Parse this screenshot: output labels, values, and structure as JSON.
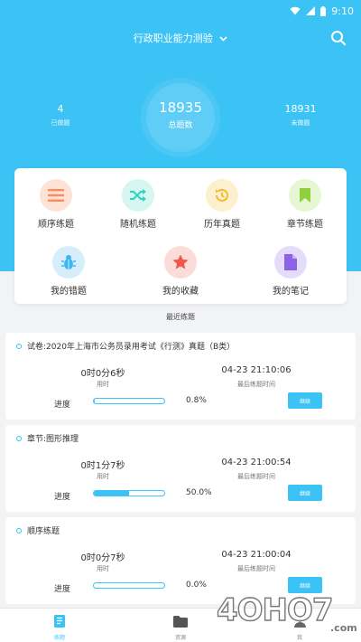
{
  "status_bar": {
    "time": "9:10"
  },
  "header": {
    "title": "行政职业能力测验",
    "stats": {
      "left": {
        "num": "4",
        "label": "已做题"
      },
      "center": {
        "num": "18935",
        "label": "总题数"
      },
      "right": {
        "num": "18931",
        "label": "未做题"
      }
    }
  },
  "menu": {
    "items": [
      {
        "label": "顺序练题",
        "icon": "list-icon",
        "color": "#ff8a5c",
        "bg": "#fde3d6"
      },
      {
        "label": "随机练题",
        "icon": "shuffle-icon",
        "color": "#2ed3c5",
        "bg": "#d6f6f2"
      },
      {
        "label": "历年真题",
        "icon": "history-icon",
        "color": "#f5b92c",
        "bg": "#fdf0cf"
      },
      {
        "label": "章节练题",
        "icon": "bookmark-icon",
        "color": "#8fd13c",
        "bg": "#e7f6d3"
      },
      {
        "label": "我的错题",
        "icon": "bug-icon",
        "color": "#3cb5f0",
        "bg": "#d6eefc"
      },
      {
        "label": "我的收藏",
        "icon": "star-icon",
        "color": "#f0564a",
        "bg": "#fcdcd8"
      },
      {
        "label": "我的笔记",
        "icon": "note-icon",
        "color": "#8c63e6",
        "bg": "#e5dcfa"
      }
    ]
  },
  "recent": {
    "title": "最近练题",
    "cards": [
      {
        "title": "试卷:2020年上海市公务员录用考试《行测》真题（B类）",
        "time_value": "0时0分6秒",
        "time_label": "用时",
        "last_value": "04-23 21:10:06",
        "last_label": "最后练题时间",
        "progress_label": "进度",
        "progress": 0.8,
        "progress_text": "0.8%",
        "button": "继续"
      },
      {
        "title": "章节:图形推理",
        "time_value": "0时1分7秒",
        "time_label": "用时",
        "last_value": "04-23 21:00:54",
        "last_label": "最后练题时间",
        "progress_label": "进度",
        "progress": 50.0,
        "progress_text": "50.0%",
        "button": "继续"
      },
      {
        "title": "顺序练题",
        "time_value": "0时0分7秒",
        "time_label": "用时",
        "last_value": "04-23 21:00:04",
        "last_label": "最后练题时间",
        "progress_label": "进度",
        "progress": 0.0,
        "progress_text": "0.0%",
        "button": "继续"
      }
    ]
  },
  "tabbar": {
    "tabs": [
      {
        "label": "练题",
        "icon": "book-icon",
        "active": true
      },
      {
        "label": "资源",
        "icon": "folder-icon",
        "active": false
      },
      {
        "label": "我",
        "icon": "person-icon",
        "active": false
      }
    ]
  },
  "watermark": {
    "text": "4OHO7",
    "suffix": ".com"
  },
  "colors": {
    "accent": "#3cc3f5"
  }
}
